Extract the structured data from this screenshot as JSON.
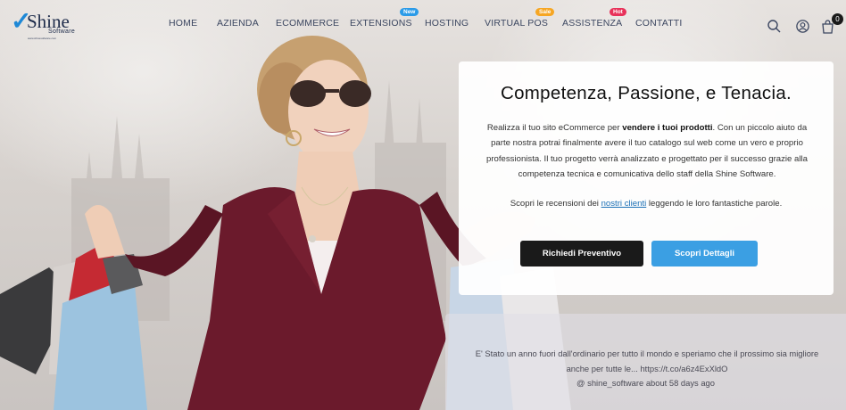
{
  "brand": {
    "name": "Shine",
    "sub": "Software",
    "tagline": "www.shinesoftware.com"
  },
  "nav": {
    "items": [
      {
        "label": "HOME"
      },
      {
        "label": "AZIENDA"
      },
      {
        "label": "ECOMMERCE"
      },
      {
        "label": "EXTENSIONS",
        "badge": "New",
        "badge_color": "#2b9be8"
      },
      {
        "label": "HOSTING"
      },
      {
        "label": "VIRTUAL POS",
        "badge": "Sale",
        "badge_color": "#f6a623"
      },
      {
        "label": "ASSISTENZA",
        "badge": "Hot",
        "badge_color": "#e8325a"
      },
      {
        "label": "CONTATTI"
      }
    ]
  },
  "header_icons": {
    "search": "search-icon",
    "account": "user-icon",
    "cart": "cart-icon",
    "cart_count": "0"
  },
  "hero": {
    "title": "Competenza, Passione, e Tenacia.",
    "p_before": "Realizza il tuo sito eCommerce per ",
    "p_bold": "vendere i tuoi prodotti",
    "p_after": ". Con un piccolo aiuto da parte nostra potrai finalmente avere il tuo catalogo sul web come un vero e proprio professionista. Il tuo progetto verrà analizzato e progettato per il successo grazie alla competenza tecnica e comunicativa dello staff della Shine Software.",
    "reviews_before": "Scopri le recensioni dei ",
    "reviews_link": "nostri clienti",
    "reviews_after": " leggendo le loro fantastiche parole.",
    "btn_quote": "Richiedi Preventivo",
    "btn_details": "Scopri Dettagli"
  },
  "tweet": {
    "text": "E' Stato un anno fuori dall'ordinario per tutto il mondo e speriamo che il prossimo sia migliore anche per tutte le... https://t.co/a6z4ExXldO",
    "handle": "@ shine_software",
    "time": "about 58 days ago"
  },
  "colors": {
    "accent_blue": "#3b9fe3",
    "dark_button": "#1a1a1a",
    "nav_text": "#3b4660"
  }
}
